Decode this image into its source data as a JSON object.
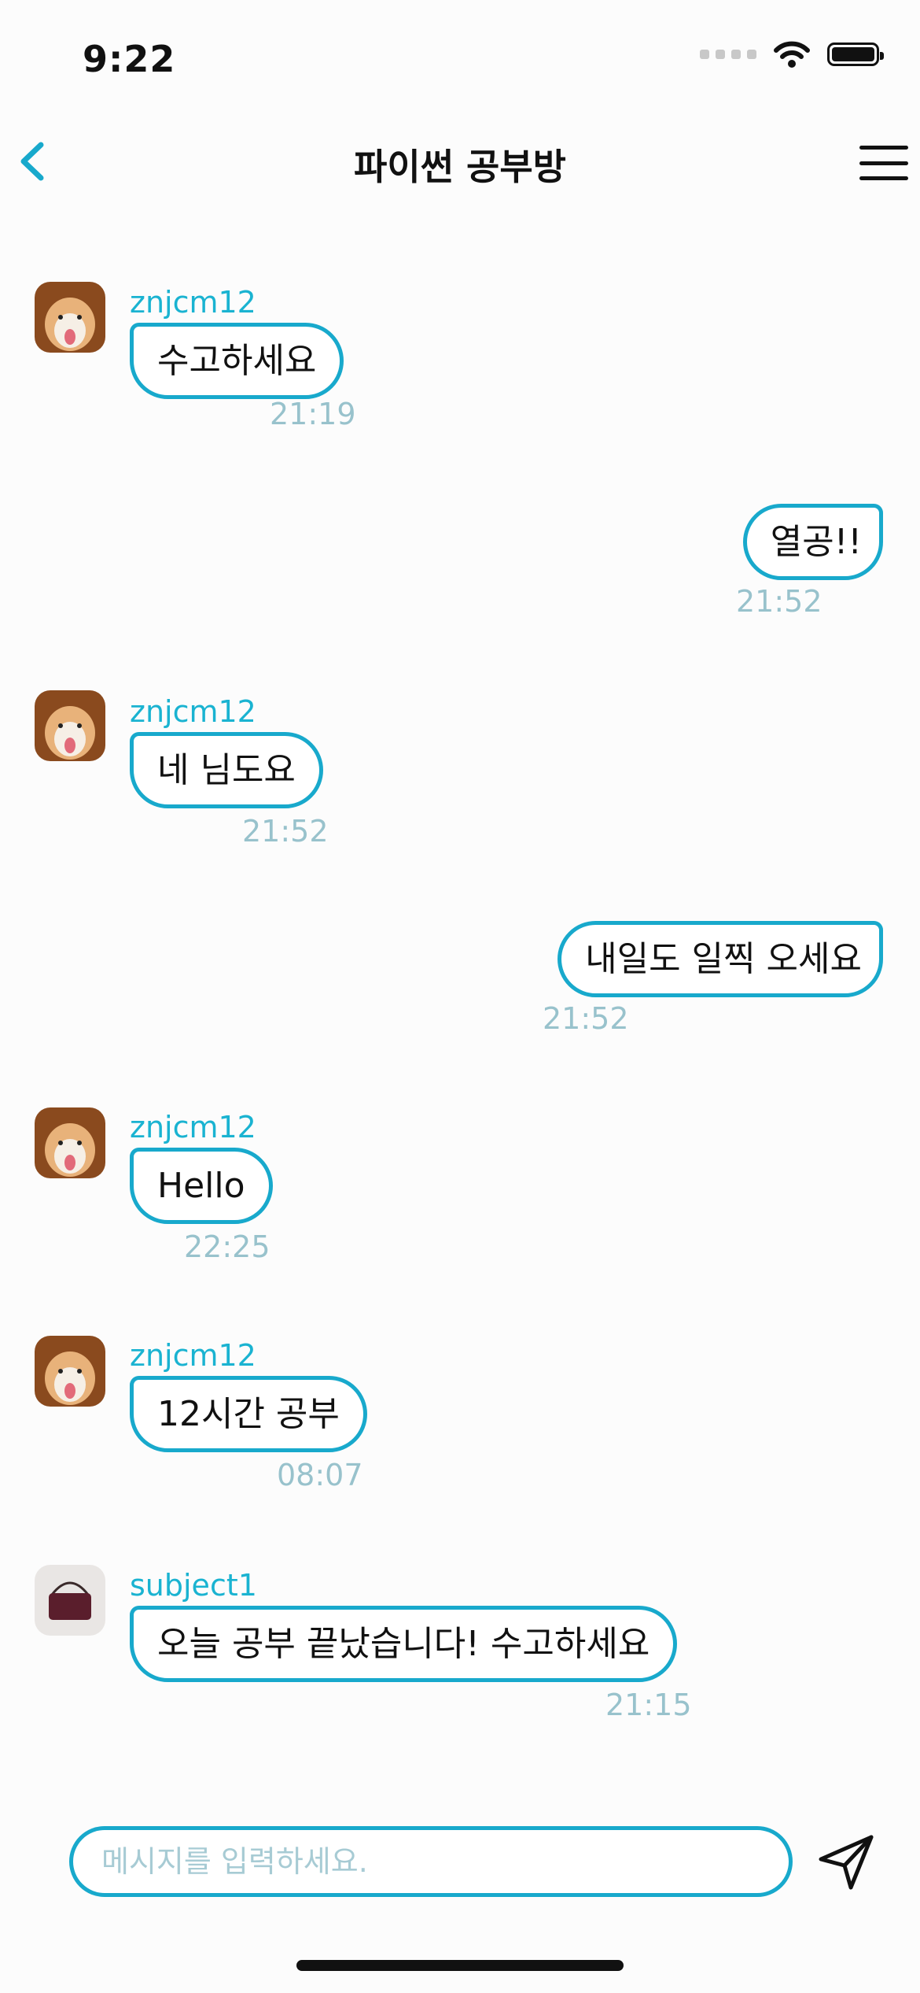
{
  "status": {
    "time": "9:22"
  },
  "header": {
    "title": "파이썬 공부방"
  },
  "messages": [
    {
      "sender": "znjcm12",
      "text": "수고하세요",
      "time": "21:19"
    },
    {
      "text": "열공!!",
      "time": "21:52"
    },
    {
      "sender": "znjcm12",
      "text": "네 님도요",
      "time": "21:52"
    },
    {
      "text": "내일도 일찍 오세요",
      "time": "21:52"
    },
    {
      "sender": "znjcm12",
      "text": "Hello",
      "time": "22:25"
    },
    {
      "sender": "znjcm12",
      "text": "12시간 공부",
      "time": "08:07"
    },
    {
      "sender": "subject1",
      "text": "오늘 공부 끝났습니다! 수고하세요",
      "time": "21:15"
    }
  ],
  "composer": {
    "placeholder": "메시지를 입력하세요."
  },
  "colors": {
    "accent": "#18a9cc",
    "timestamp": "#98c2cc"
  }
}
